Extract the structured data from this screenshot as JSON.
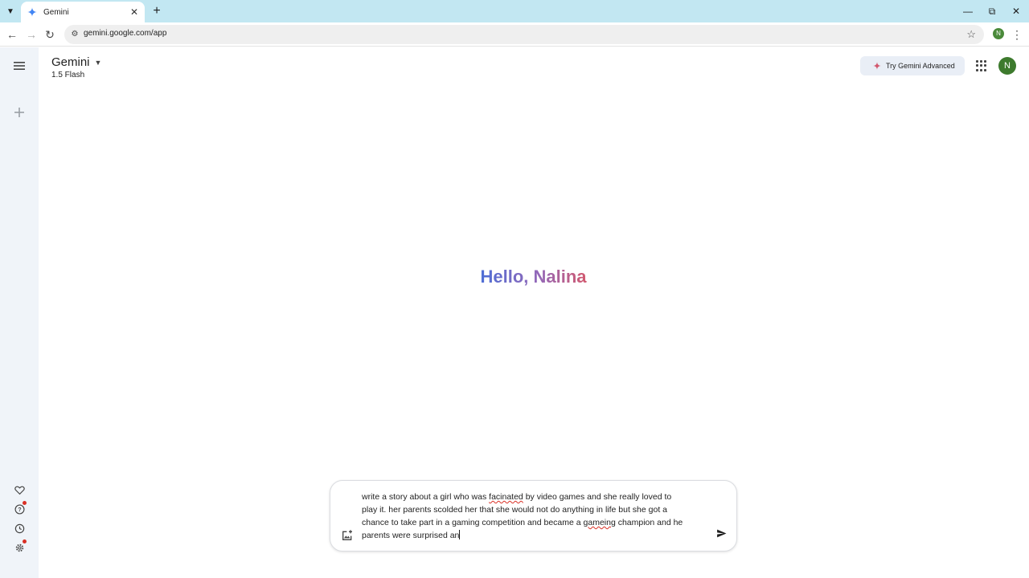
{
  "browser": {
    "tab_title": "Gemini",
    "url": "gemini.google.com/app",
    "profile_initial": "N"
  },
  "app": {
    "model_name": "Gemini",
    "model_version": "1.5 Flash",
    "advanced_button_label": "Try Gemini Advanced",
    "avatar_initial": "N",
    "greeting": "Hello, Nalina"
  },
  "prompt": {
    "line1_a": "write a story about a girl who was ",
    "line1_sq": "facinated",
    "line1_b": " by video games and she really loved to",
    "line2": "play it. her parents scolded her that she would not do anything in life but she got a",
    "line3_a": "chance to take part in a gaming competition and became a ",
    "line3_sq": "gameing",
    "line3_b": " champion and he",
    "line4": "parents were surprised an"
  },
  "colors": {
    "sidebar_bg": "#f0f4f9",
    "tabstrip_bg": "#c2e7f2",
    "greeting_start": "#4e6fd6",
    "greeting_end": "#d2596f",
    "notification_dot": "#d93025"
  },
  "icons": {
    "menu": "hamburger-icon",
    "new_chat": "plus-icon",
    "gems": "gem-heart-icon",
    "help": "help-icon",
    "activity": "history-icon",
    "settings": "gear-icon",
    "upload": "image-upload-icon",
    "send": "send-icon"
  }
}
